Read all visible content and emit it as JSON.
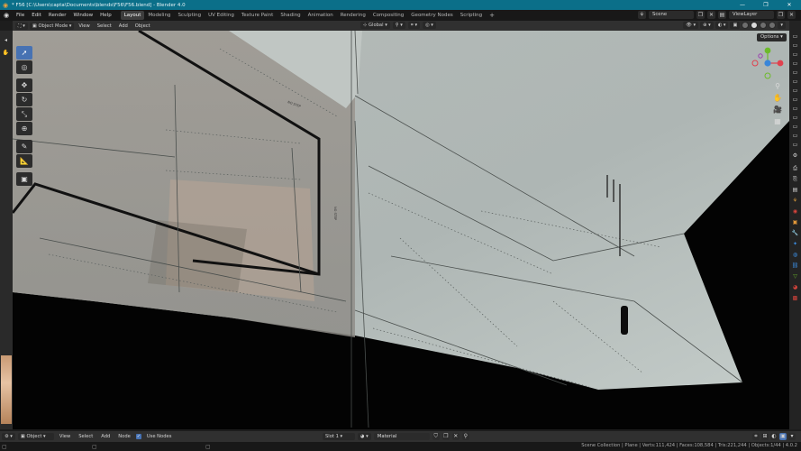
{
  "window": {
    "title": "* F56 [C:\\Users\\capta\\Documents\\blends\\F56\\F56.blend] - Blender 4.0",
    "minimize": "—",
    "maximize": "❐",
    "close": "✕"
  },
  "menu": [
    "File",
    "Edit",
    "Render",
    "Window",
    "Help"
  ],
  "workspaces": [
    {
      "label": "Layout",
      "active": true
    },
    {
      "label": "Modeling",
      "active": false
    },
    {
      "label": "Sculpting",
      "active": false
    },
    {
      "label": "UV Editing",
      "active": false
    },
    {
      "label": "Texture Paint",
      "active": false
    },
    {
      "label": "Shading",
      "active": false
    },
    {
      "label": "Animation",
      "active": false
    },
    {
      "label": "Rendering",
      "active": false
    },
    {
      "label": "Compositing",
      "active": false
    },
    {
      "label": "Geometry Nodes",
      "active": false
    },
    {
      "label": "Scripting",
      "active": false
    }
  ],
  "add_workspace": "+",
  "scene": {
    "label": "Scene",
    "view_layer": "ViewLayer"
  },
  "viewport_header": {
    "mode": "Object Mode",
    "menus": [
      "View",
      "Select",
      "Add",
      "Object"
    ],
    "orientation": "Global",
    "options": "Options"
  },
  "toolbar_icons": [
    "select-box-icon",
    "cursor-icon",
    "move-icon",
    "rotate-icon",
    "scale-icon",
    "transform-icon",
    "annotate-icon",
    "measure-icon",
    "add-cube-icon"
  ],
  "shader_header": {
    "editor": "Object",
    "menus": [
      "View",
      "Select",
      "Add",
      "Node"
    ],
    "use_nodes": "Use Nodes",
    "slot": "Slot 1",
    "material": "Material"
  },
  "status": {
    "stats": "Scene Collection | Plane | Verts:111,424 | Faces:108,584 | Tris:221,244 | Objects:1/44 | 4.0.2"
  },
  "panel_text": {
    "marking_a": "NO STEP",
    "marking_b": "NO STEP"
  },
  "colors": {
    "accent": "#4772b3",
    "titlebar": "#0b6f89",
    "axis_x": "#e0424f",
    "axis_y": "#6dbb2a",
    "axis_z": "#3a86d9"
  }
}
